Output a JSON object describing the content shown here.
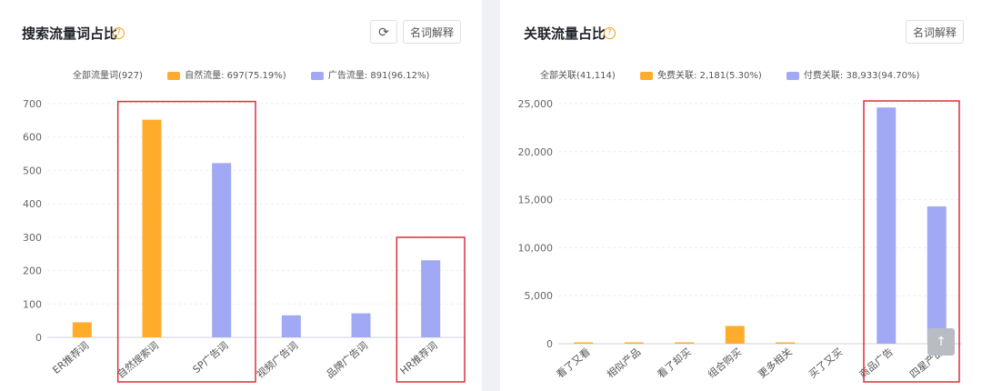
{
  "left": {
    "title": "搜索流量词占比",
    "explain_label": "名词解释",
    "legend": [
      {
        "label": "全部流量词(927)"
      },
      {
        "label": "自然流量: 697(75.19%)",
        "color": "#ffac2d"
      },
      {
        "label": "广告流量: 891(96.12%)",
        "color": "#a2a9f4"
      }
    ]
  },
  "right": {
    "title": "关联流量占比",
    "explain_label": "名词解释",
    "legend": [
      {
        "label": "全部关联(41,114)"
      },
      {
        "label": "免费关联: 2,181(5.30%)",
        "color": "#ffac2d"
      },
      {
        "label": "付费关联: 38,933(94.70%)",
        "color": "#a2a9f4"
      }
    ]
  },
  "chart_data": [
    {
      "type": "bar",
      "categories": [
        "ER推荐词",
        "自然搜索词",
        "SP广告词",
        "视频广告词",
        "品牌广告词",
        "HR推荐词"
      ],
      "values": [
        45,
        652,
        522,
        66,
        72,
        231
      ],
      "colors": [
        "#ffac2d",
        "#ffac2d",
        "#a2a9f4",
        "#a2a9f4",
        "#a2a9f4",
        "#a2a9f4"
      ],
      "ylim": [
        0,
        700
      ],
      "yticks": [
        0,
        100,
        200,
        300,
        400,
        500,
        600,
        700
      ],
      "ytick_labels": [
        "0",
        "100",
        "200",
        "300",
        "400",
        "500",
        "600",
        "700"
      ],
      "highlight_groups": [
        [
          "自然搜索词",
          "SP广告词"
        ],
        [
          "HR推荐词"
        ]
      ],
      "grid": true
    },
    {
      "type": "bar",
      "categories": [
        "看了又看",
        "相似产品",
        "看了却买",
        "组合购买",
        "更多相关",
        "买了又买",
        "商品广告",
        "四星产品"
      ],
      "values": [
        120,
        40,
        80,
        1850,
        50,
        0,
        24600,
        14300
      ],
      "colors": [
        "#ffac2d",
        "#ffac2d",
        "#ffac2d",
        "#ffac2d",
        "#ffac2d",
        "#ffac2d",
        "#a2a9f4",
        "#a2a9f4"
      ],
      "ylim": [
        0,
        25000
      ],
      "yticks": [
        0,
        5000,
        10000,
        15000,
        20000,
        25000
      ],
      "ytick_labels": [
        "0",
        "5,000",
        "10,000",
        "15,000",
        "20,000",
        "25,000"
      ],
      "highlight_groups": [
        [
          "商品广告",
          "四星产品"
        ]
      ],
      "grid": true
    }
  ]
}
